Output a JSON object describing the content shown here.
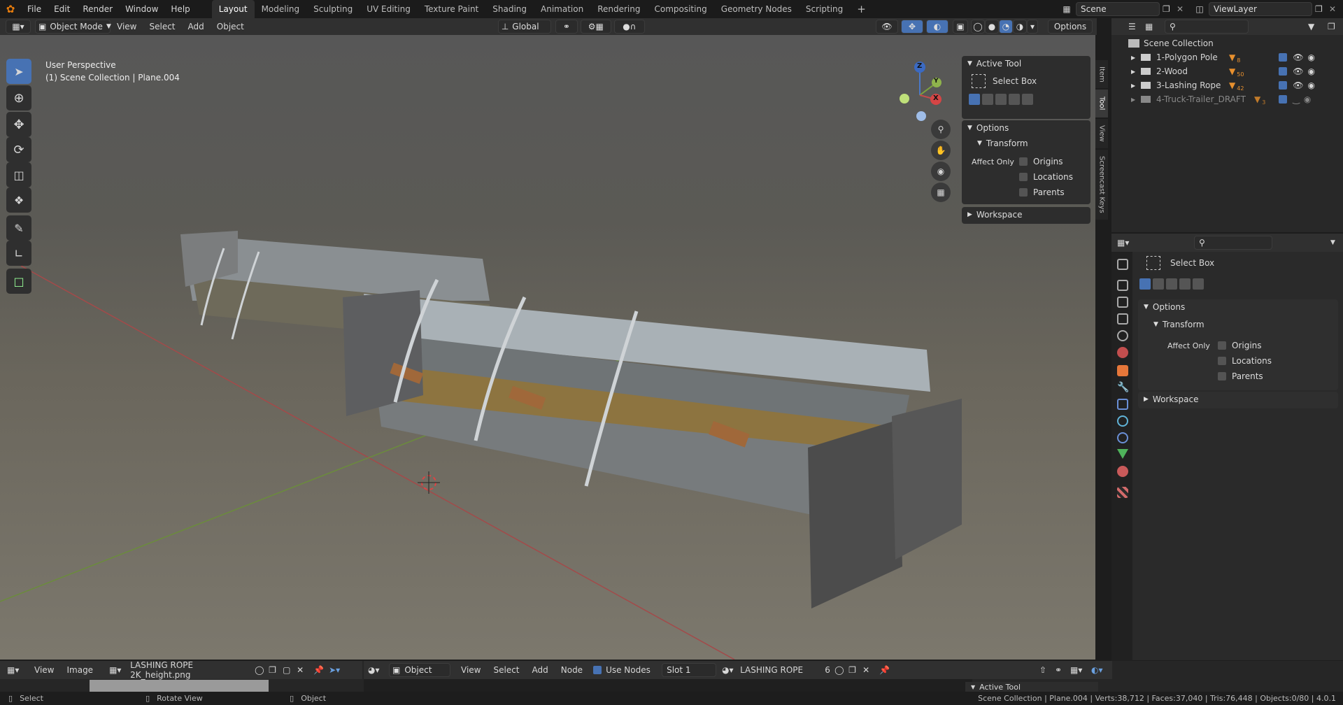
{
  "menubar": {
    "items": [
      "File",
      "Edit",
      "Render",
      "Window",
      "Help"
    ],
    "workspaces": [
      "Layout",
      "Modeling",
      "Sculpting",
      "UV Editing",
      "Texture Paint",
      "Shading",
      "Animation",
      "Rendering",
      "Compositing",
      "Geometry Nodes",
      "Scripting"
    ],
    "active_workspace": "Layout",
    "add_tab": "+",
    "scene_label": "Scene",
    "viewlayer_label": "ViewLayer"
  },
  "viewport_header": {
    "mode": "Object Mode",
    "menus": [
      "View",
      "Select",
      "Add",
      "Object"
    ],
    "orientation": "Global",
    "options_label": "Options"
  },
  "viewport": {
    "perspective": "User Perspective",
    "context": "(1) Scene Collection | Plane.004",
    "gizmo": {
      "z": "Z",
      "x": "X",
      "y": "Y"
    }
  },
  "npanel": {
    "active_tool_title": "Active Tool",
    "tool_name": "Select Box",
    "options_title": "Options",
    "transform_title": "Transform",
    "affect_only": "Affect Only",
    "checkboxes": [
      "Origins",
      "Locations",
      "Parents"
    ],
    "workspace_title": "Workspace",
    "tabs": [
      "Item",
      "Tool",
      "View",
      "Screencast Keys"
    ]
  },
  "outliner": {
    "root": "Scene Collection",
    "rows": [
      {
        "name": "1-Polygon Pole",
        "count": "8"
      },
      {
        "name": "2-Wood",
        "count": "50"
      },
      {
        "name": "3-Lashing Rope",
        "count": "42"
      },
      {
        "name": "4-Truck-Trailer_DRAFT",
        "count": "3"
      }
    ]
  },
  "properties": {
    "tool_name": "Select Box",
    "options_title": "Options",
    "transform_title": "Transform",
    "affect_only": "Affect Only",
    "checkboxes": [
      "Origins",
      "Locations",
      "Parents"
    ],
    "workspace_title": "Workspace",
    "tab_colors": [
      "#bbbbbb",
      "#c8c8c8",
      "#c8c8c8",
      "#c8c8c8",
      "#d08a3d",
      "#c24e4e",
      "#e6773a",
      "#4aa3df",
      "#6a8fd6",
      "#60b3d7",
      "#4fb35b",
      "#c95a5a",
      "#d26a6a"
    ]
  },
  "image_editor": {
    "menus": [
      "View",
      "Image"
    ],
    "image_name": "LASHING ROPE 2K_height.png"
  },
  "node_editor": {
    "object_type": "Object",
    "menus": [
      "View",
      "Select",
      "Add",
      "Node"
    ],
    "use_nodes": "Use Nodes",
    "slot": "Slot 1",
    "material": "LASHING ROPE",
    "users": "6",
    "active_tool_peek": "Active Tool"
  },
  "statusbar": {
    "select": "Select",
    "rotate": "Rotate View",
    "object": "Object",
    "stats": "Scene Collection | Plane.004 | Verts:38,712 | Faces:37,040 | Tris:76,448 | Objects:0/80 | 4.0.1"
  }
}
